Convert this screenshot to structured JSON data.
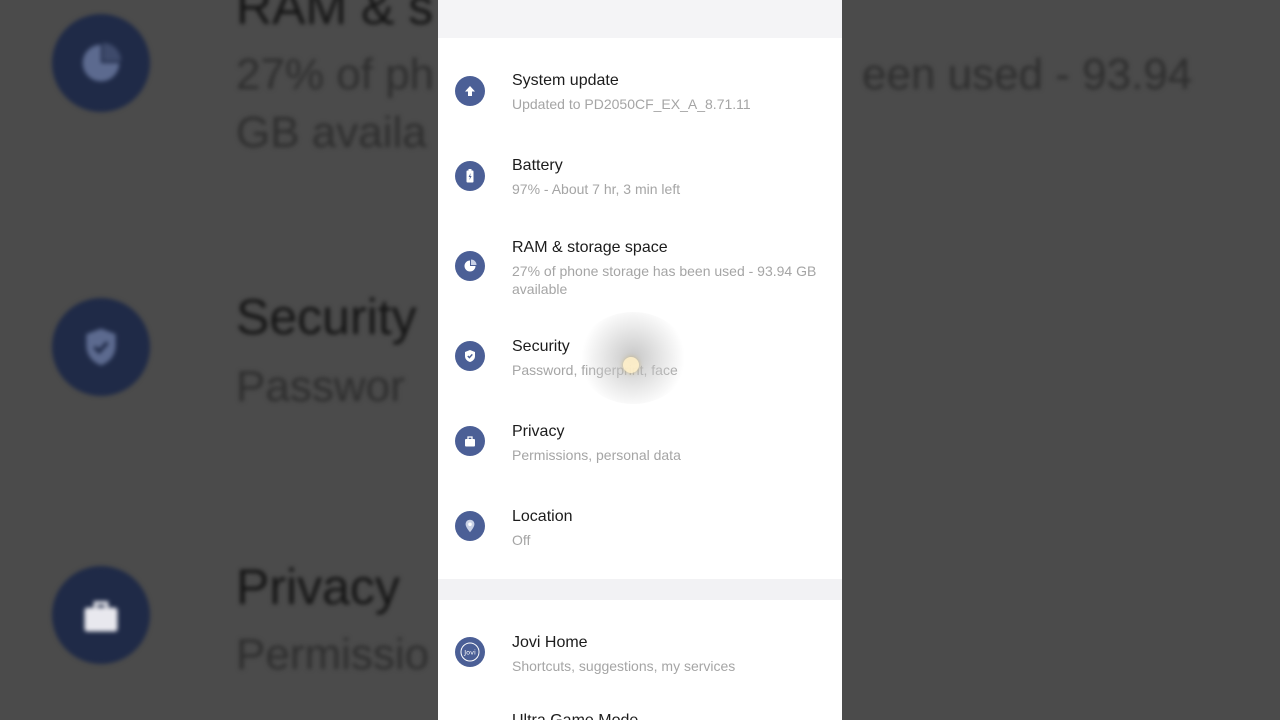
{
  "background": {
    "items": [
      {
        "title": "RAM & s",
        "subtitle_lines": [
          "27% of ph",
          "GB availa"
        ]
      },
      {
        "title": "Security",
        "subtitle_lines": [
          "Passwor"
        ]
      },
      {
        "title": "Privacy",
        "subtitle_lines": [
          "Permissio"
        ]
      }
    ],
    "right_fragment": "een used - 93.94"
  },
  "settings": {
    "items": [
      {
        "title": "System update",
        "subtitle": "Updated to PD2050CF_EX_A_8.71.11",
        "icon": "arrow-up-icon"
      },
      {
        "title": "Battery",
        "subtitle": "97% - About 7 hr, 3 min left",
        "icon": "battery-icon"
      },
      {
        "title": "RAM & storage space",
        "subtitle": "27% of phone storage has been used - 93.94 GB available",
        "icon": "pie-chart-icon"
      },
      {
        "title": "Security",
        "subtitle": "Password, fingerprint, face",
        "icon": "shield-check-icon"
      },
      {
        "title": "Privacy",
        "subtitle": "Permissions, personal data",
        "icon": "briefcase-icon"
      },
      {
        "title": "Location",
        "subtitle": "Off",
        "icon": "location-pin-icon"
      }
    ],
    "second_group": [
      {
        "title": "Jovi Home",
        "subtitle": "Shortcuts, suggestions, my services",
        "icon": "jovi-icon",
        "icon_text": "Jovi"
      },
      {
        "title": "Ultra Game Mode",
        "subtitle": "",
        "icon": ""
      }
    ]
  },
  "colors": {
    "icon_bg": "#4b5f96",
    "bg_icon": "#1f2a47",
    "subtitle": "#a5a5a5"
  }
}
